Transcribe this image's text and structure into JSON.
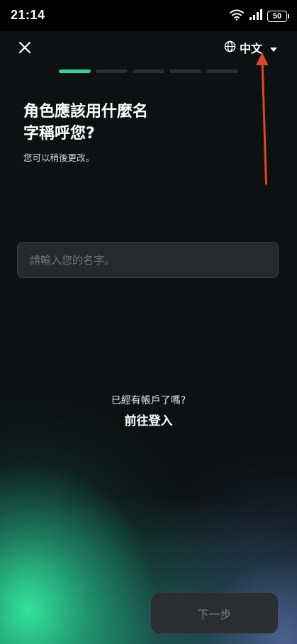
{
  "status_bar": {
    "time": "21:14",
    "battery": "50",
    "icons": [
      "wifi-icon",
      "signal-icon",
      "battery-icon"
    ]
  },
  "header": {
    "close_icon": "close-icon",
    "language_icon": "globe-icon",
    "language_label": "中文",
    "dropdown_icon": "caret-down-icon"
  },
  "progress": {
    "total_steps": 5,
    "current_step": 1
  },
  "main": {
    "title": "角色應該用什麼名字稱呼您?",
    "subtitle": "您可以稍後更改。",
    "name_input": {
      "placeholder": "請輸入您的名字。",
      "value": ""
    }
  },
  "account": {
    "question": "已經有帳戶了嗎?",
    "login_label": "前往登入"
  },
  "footer": {
    "next_label": "下一步"
  },
  "colors": {
    "accent": "#2fd79a",
    "background": "#0d1112",
    "annotation": "#e0452d"
  }
}
